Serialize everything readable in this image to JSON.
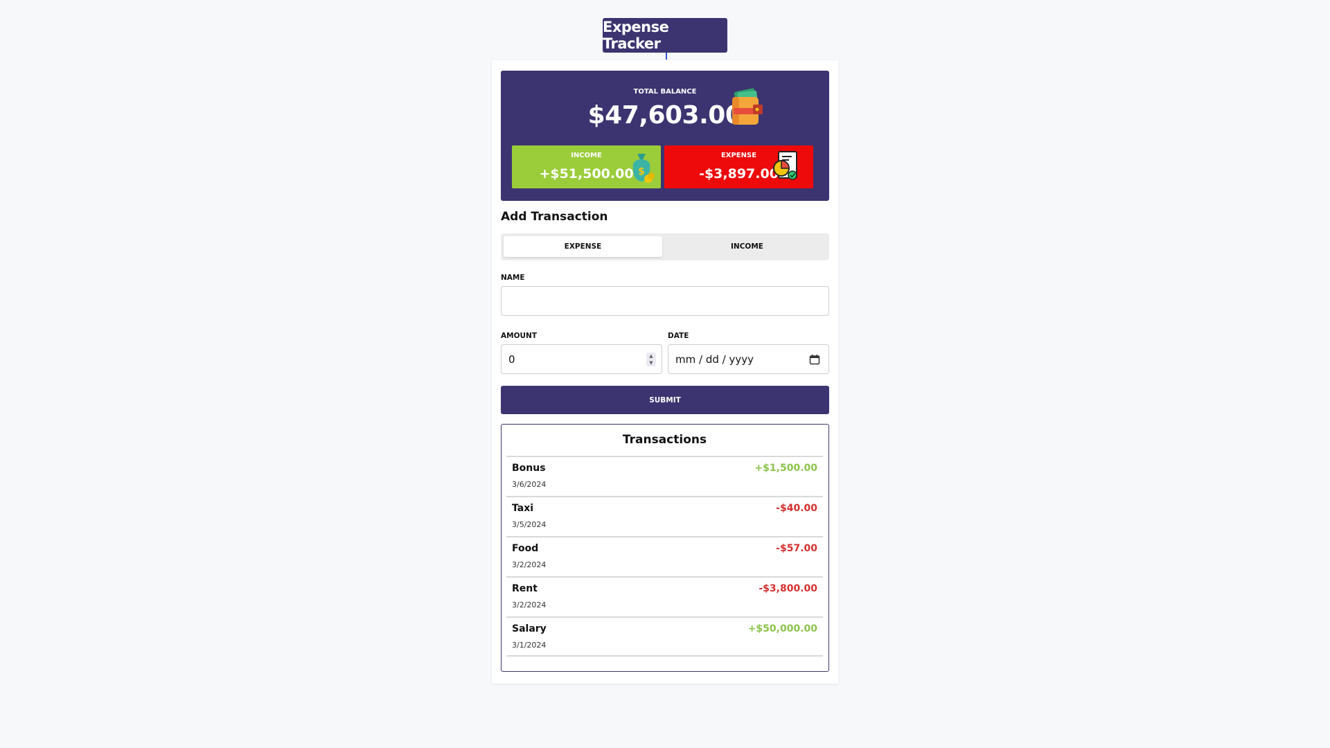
{
  "app": {
    "title": "Expense Tracker"
  },
  "balance": {
    "total_label": "TOTAL BALANCE",
    "total_value": "$47,603.00",
    "income_label": "INCOME",
    "income_value": "+$51,500.00",
    "expense_label": "EXPENSE",
    "expense_value": "-$3,897.00",
    "icons": [
      "wallet-icon",
      "money-bag-icon",
      "report-chart-icon"
    ]
  },
  "form": {
    "section_title": "Add Transaction",
    "type_toggle": {
      "options": [
        "EXPENSE",
        "INCOME"
      ],
      "selected": "EXPENSE"
    },
    "name_label": "NAME",
    "name_value": "",
    "amount_label": "AMOUNT",
    "amount_value": "0",
    "date_label": "DATE",
    "date_placeholder": "mm / dd / yyyy",
    "submit_label": "SUBMIT"
  },
  "transactions": {
    "title": "Transactions",
    "items": [
      {
        "name": "Bonus",
        "date": "3/6/2024",
        "amount": "+$1,500.00",
        "kind": "income"
      },
      {
        "name": "Taxi",
        "date": "3/5/2024",
        "amount": "-$40.00",
        "kind": "expense"
      },
      {
        "name": "Food",
        "date": "3/2/2024",
        "amount": "-$57.00",
        "kind": "expense"
      },
      {
        "name": "Rent",
        "date": "3/2/2024",
        "amount": "-$3,800.00",
        "kind": "expense"
      },
      {
        "name": "Salary",
        "date": "3/1/2024",
        "amount": "+$50,000.00",
        "kind": "income"
      }
    ]
  },
  "colors": {
    "primary": "#3b3470",
    "income": "#9bcc3a",
    "expense": "#ee0a0a",
    "income_text": "#8bc34a",
    "expense_text": "#d32f2f",
    "background": "#f7f8fa"
  }
}
